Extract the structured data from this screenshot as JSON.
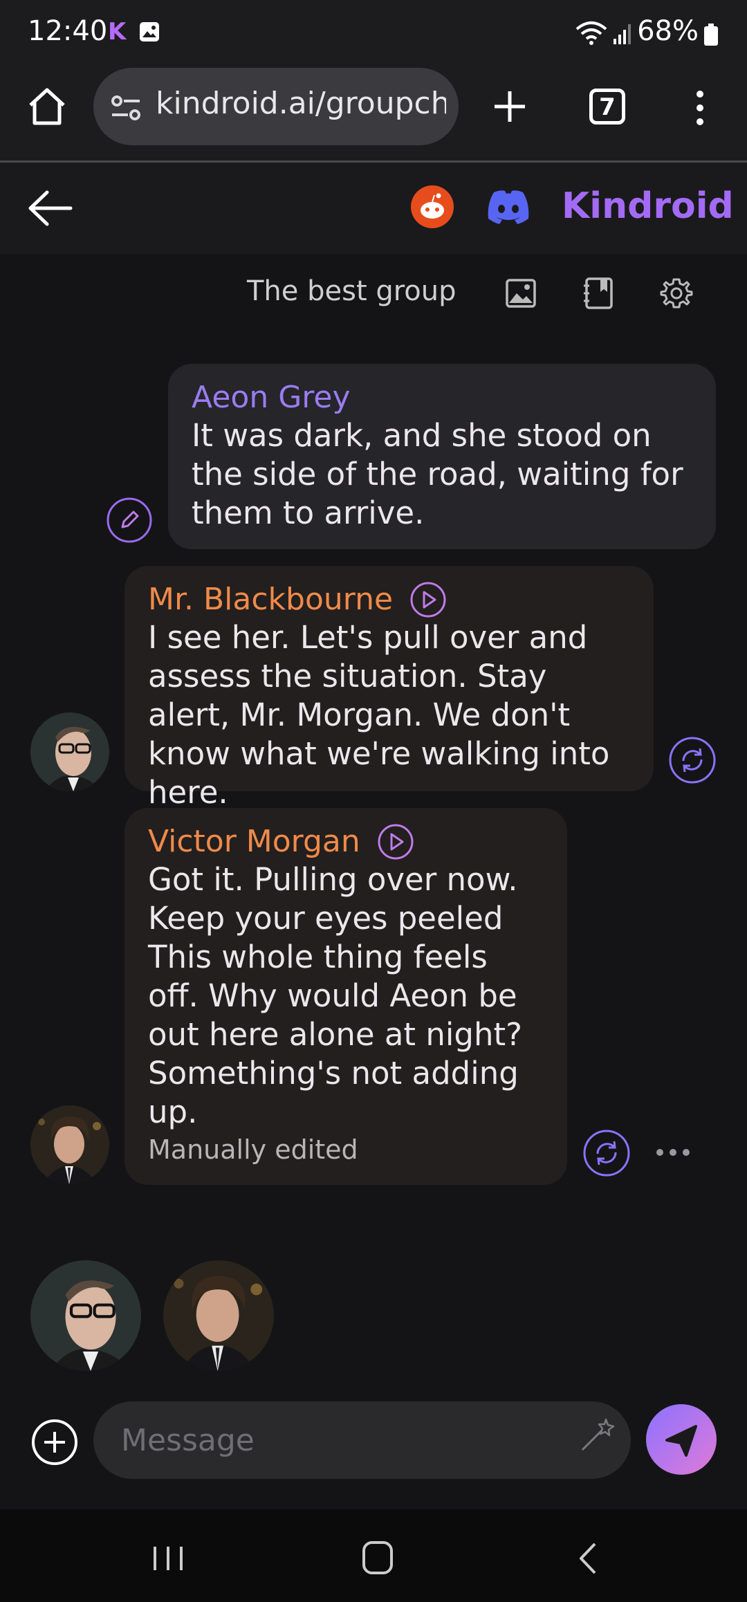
{
  "status": {
    "time": "12:40",
    "app_badge": "K",
    "battery": "68%"
  },
  "browser": {
    "url": "kindroid.ai/groupcha",
    "tab_count": "7"
  },
  "header": {
    "brand": "Kindroid"
  },
  "group": {
    "name": "The best group"
  },
  "messages": [
    {
      "sender": "Aeon Grey",
      "role": "user",
      "text": "It was dark, and she stood on the side of the road, waiting for them to arrive."
    },
    {
      "sender": "Mr. Blackbourne",
      "role": "ai",
      "text": "I see her. Let's pull over and assess the situation. Stay alert, Mr. Morgan. We don't know what we're walking into here."
    },
    {
      "sender": "Victor Morgan",
      "role": "ai",
      "text": "Got it. Pulling over now. Keep your eyes peeled This whole thing feels off. Why would Aeon be out here alone at night? Something's not adding up.",
      "note": "Manually edited"
    }
  ],
  "composer": {
    "placeholder": "Message"
  },
  "colors": {
    "accent": "#9b7cf1",
    "ai_name": "#f18a4a",
    "brand": "#a36bf5"
  },
  "icons": [
    "home-icon",
    "site-settings-icon",
    "plus-icon",
    "more-icon",
    "back-arrow-icon",
    "reddit-icon",
    "discord-icon",
    "image-icon",
    "journal-icon",
    "gear-icon",
    "edit-pencil-icon",
    "play-icon",
    "regenerate-icon",
    "magic-wand-icon",
    "send-icon"
  ]
}
